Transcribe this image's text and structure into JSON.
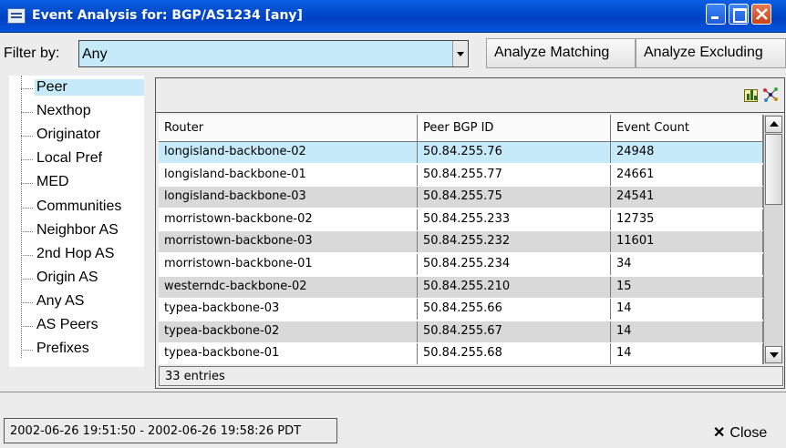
{
  "window": {
    "title": "Event Analysis for: BGP/AS1234 [any]"
  },
  "filter": {
    "label": "Filter by:",
    "value": "Any"
  },
  "buttons": {
    "analyze_matching": "Analyze Matching",
    "analyze_excluding": "Analyze Excluding",
    "close": "Close",
    "close_glyph": "✕"
  },
  "tree": {
    "items": [
      "Peer",
      "Nexthop",
      "Originator",
      "Local Pref",
      "MED",
      "Communities",
      "Neighbor AS",
      "2nd Hop AS",
      "Origin AS",
      "Any AS",
      "AS Peers",
      "Prefixes"
    ],
    "selected": 0
  },
  "table": {
    "columns": [
      "Router",
      "Peer BGP ID",
      "Event Count"
    ],
    "rows": [
      [
        "longisland-backbone-02",
        "50.84.255.76",
        "24948"
      ],
      [
        "longisland-backbone-01",
        "50.84.255.77",
        "24661"
      ],
      [
        "longisland-backbone-03",
        "50.84.255.75",
        "24541"
      ],
      [
        "morristown-backbone-02",
        "50.84.255.233",
        "12735"
      ],
      [
        "morristown-backbone-03",
        "50.84.255.232",
        "11601"
      ],
      [
        "morristown-backbone-01",
        "50.84.255.234",
        "34"
      ],
      [
        "westerndc-backbone-02",
        "50.84.255.210",
        "15"
      ],
      [
        "typea-backbone-03",
        "50.84.255.66",
        "14"
      ],
      [
        "typea-backbone-02",
        "50.84.255.67",
        "14"
      ],
      [
        "typea-backbone-01",
        "50.84.255.68",
        "14"
      ]
    ],
    "selected_row": 0,
    "entries_text": "33 entries"
  },
  "status": {
    "time_range": "2002-06-26 19:51:50 - 2002-06-26 19:58:26 PDT"
  },
  "colors": {
    "selection": "#c7eafa",
    "row_alt": "#d9d9d9",
    "titlebar": "#0a5fe2"
  },
  "icons": [
    "app-icon",
    "minimize-icon",
    "maximize-icon",
    "close-window-icon",
    "dropdown-arrow-icon",
    "bar-chart-icon",
    "network-graph-icon",
    "scroll-up-icon",
    "scroll-down-icon",
    "close-x-icon"
  ]
}
